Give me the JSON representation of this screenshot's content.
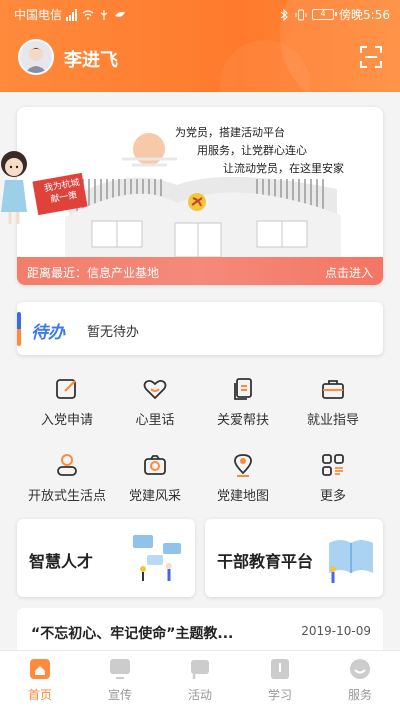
{
  "status_bar": {
    "carrier": "中国电信",
    "battery": "4",
    "time": "傍晚5:56"
  },
  "header": {
    "username": "李进飞"
  },
  "banner": {
    "slogans": [
      "为党员，搭建活动平台",
      "用服务，让党群心连心",
      "让流动党员，在这里安家"
    ],
    "tag_line1": "我为杭城",
    "tag_line2": "献一策",
    "distance_text": "距离最近：信息产业基地",
    "enter_label": "点击进入"
  },
  "todo": {
    "title": "待办",
    "text": "暂无待办"
  },
  "menu": [
    {
      "label": "入党申请",
      "icon": "edit-icon"
    },
    {
      "label": "心里话",
      "icon": "heart-icon"
    },
    {
      "label": "关爱帮扶",
      "icon": "documents-icon"
    },
    {
      "label": "就业指导",
      "icon": "briefcase-icon"
    },
    {
      "label": "开放式生活点",
      "icon": "person-icon"
    },
    {
      "label": "党建风采",
      "icon": "camera-icon"
    },
    {
      "label": "党建地图",
      "icon": "map-pin-icon"
    },
    {
      "label": "更多",
      "icon": "more-grid-icon"
    }
  ],
  "cards": [
    {
      "title": "智慧人才"
    },
    {
      "title": "干部教育平台"
    }
  ],
  "news": {
    "title": "“不忘初心、牢记使命”主题教...",
    "date": "2019-10-09"
  },
  "tabs": [
    {
      "label": "首页",
      "icon": "home-icon",
      "active": true
    },
    {
      "label": "宣传",
      "icon": "monitor-icon",
      "active": false
    },
    {
      "label": "活动",
      "icon": "flag-icon",
      "active": false
    },
    {
      "label": "学习",
      "icon": "book-icon",
      "active": false
    },
    {
      "label": "服务",
      "icon": "smile-icon",
      "active": false
    }
  ],
  "colors": {
    "accent": "#ff8a3c",
    "todo_blue": "#3b7bea",
    "banner_strip": "#f27d6b"
  }
}
